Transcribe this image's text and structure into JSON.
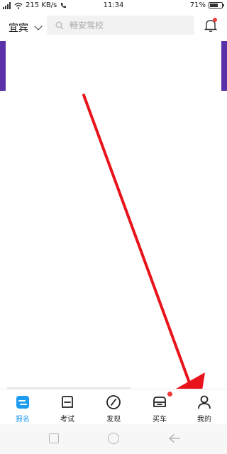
{
  "status": {
    "speed": "215 KB/s",
    "time": "11:34",
    "battery": "71%",
    "battery_level": 0.71
  },
  "header": {
    "city": "宜宾",
    "search_placeholder": "畅安驾校"
  },
  "nav": {
    "items": [
      {
        "label": "报名",
        "icon": "signup-icon",
        "active": true
      },
      {
        "label": "考试",
        "icon": "exam-icon"
      },
      {
        "label": "发现",
        "icon": "discover-icon"
      },
      {
        "label": "买车",
        "icon": "buy-car-icon",
        "badge": true
      },
      {
        "label": "我的",
        "icon": "profile-icon"
      }
    ]
  },
  "colors": {
    "accent": "#1d9bf0",
    "badge": "#f03b3b",
    "arrow": "#e8131b",
    "banner_edge": "#5a31a8"
  }
}
